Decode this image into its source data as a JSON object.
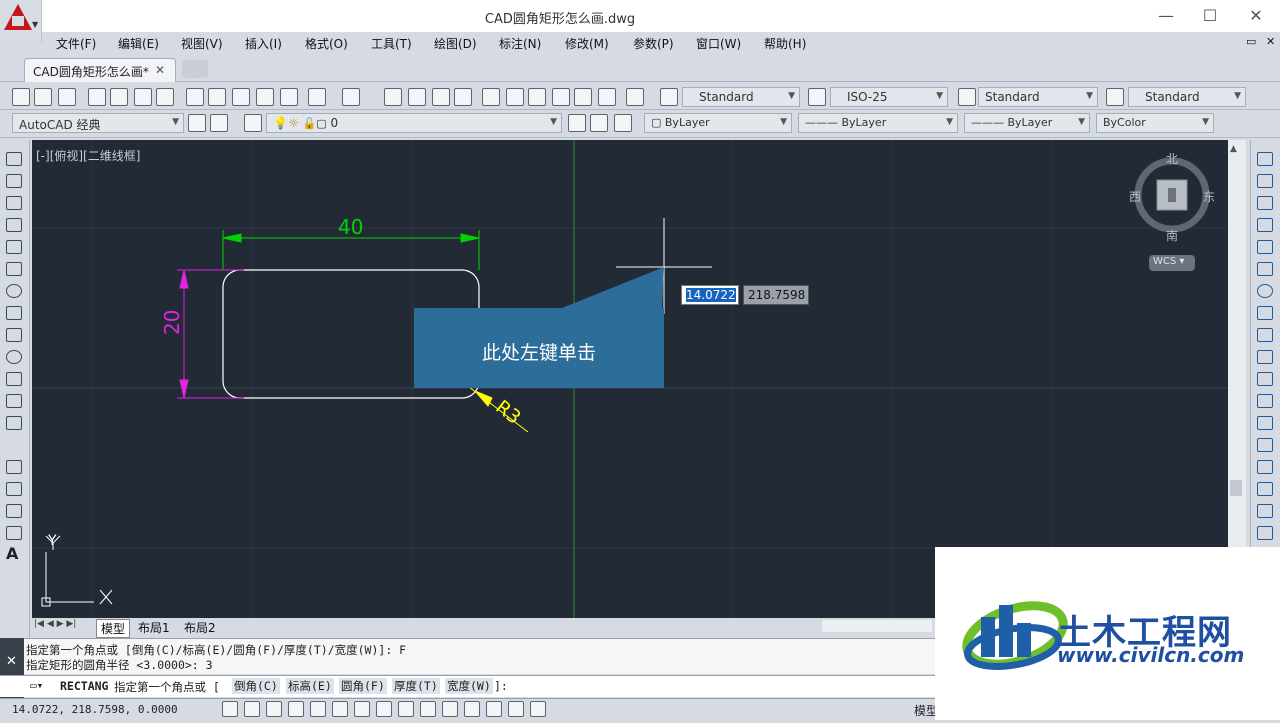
{
  "window": {
    "title": "CAD圆角矩形怎么画.dwg",
    "minimize": "—",
    "maximize": "☐",
    "close": "✕"
  },
  "menu": [
    "文件(F)",
    "编辑(E)",
    "视图(V)",
    "插入(I)",
    "格式(O)",
    "工具(T)",
    "绘图(D)",
    "标注(N)",
    "修改(M)",
    "参数(P)",
    "窗口(W)",
    "帮助(H)"
  ],
  "tabs": {
    "document": "CAD圆角矩形怎么画*",
    "close": "✕"
  },
  "styles": {
    "text_style": "Standard",
    "dim_style": "ISO-25",
    "table_style": "Standard",
    "multileader_style": "Standard"
  },
  "workspace": "AutoCAD 经典",
  "layer": {
    "name": "0"
  },
  "properties": {
    "color": "ByLayer",
    "linetype": "ByLayer",
    "lineweight": "ByLayer",
    "plotstyle": "ByColor"
  },
  "viewport": {
    "label": "[-][俯视][二维线框]"
  },
  "viewcube": {
    "north": "北",
    "south": "南",
    "east": "东",
    "west": "西",
    "ucs": "WCS"
  },
  "drawing": {
    "width_dim": "40",
    "height_dim": "20",
    "radius_dim": "R3",
    "ucs_x": "X",
    "ucs_y": "Y",
    "colors": {
      "background": "#222a36",
      "dim_green": "#00d400",
      "dim_magenta": "#e024e0",
      "dim_yellow": "#ffff00",
      "geometry": "#ffffff"
    }
  },
  "dynamic_input": {
    "x": "14.0722",
    "y": "218.7598"
  },
  "callout": {
    "text": "此处左键单击",
    "color": "#2c6d9a"
  },
  "layout_tabs": [
    "模型",
    "布局1",
    "布局2"
  ],
  "command": {
    "history": [
      "指定第一个角点或 [倒角(C)/标高(E)/圆角(F)/厚度(T)/宽度(W)]: F",
      "指定矩形的圆角半径 <3.0000>: 3"
    ],
    "prompt_name": "RECTANG",
    "prompt_text": "指定第一个角点或 [",
    "options": [
      "倒角(C)",
      "标高(E)",
      "圆角(F)",
      "厚度(T)",
      "宽度(W)"
    ],
    "prompt_end": "]:"
  },
  "status": {
    "coordinates": "14.0722,  218.7598, 0.0000",
    "model": "模型"
  },
  "watermark": {
    "brand": "土木工程网",
    "url": "www.civilcn.com"
  }
}
